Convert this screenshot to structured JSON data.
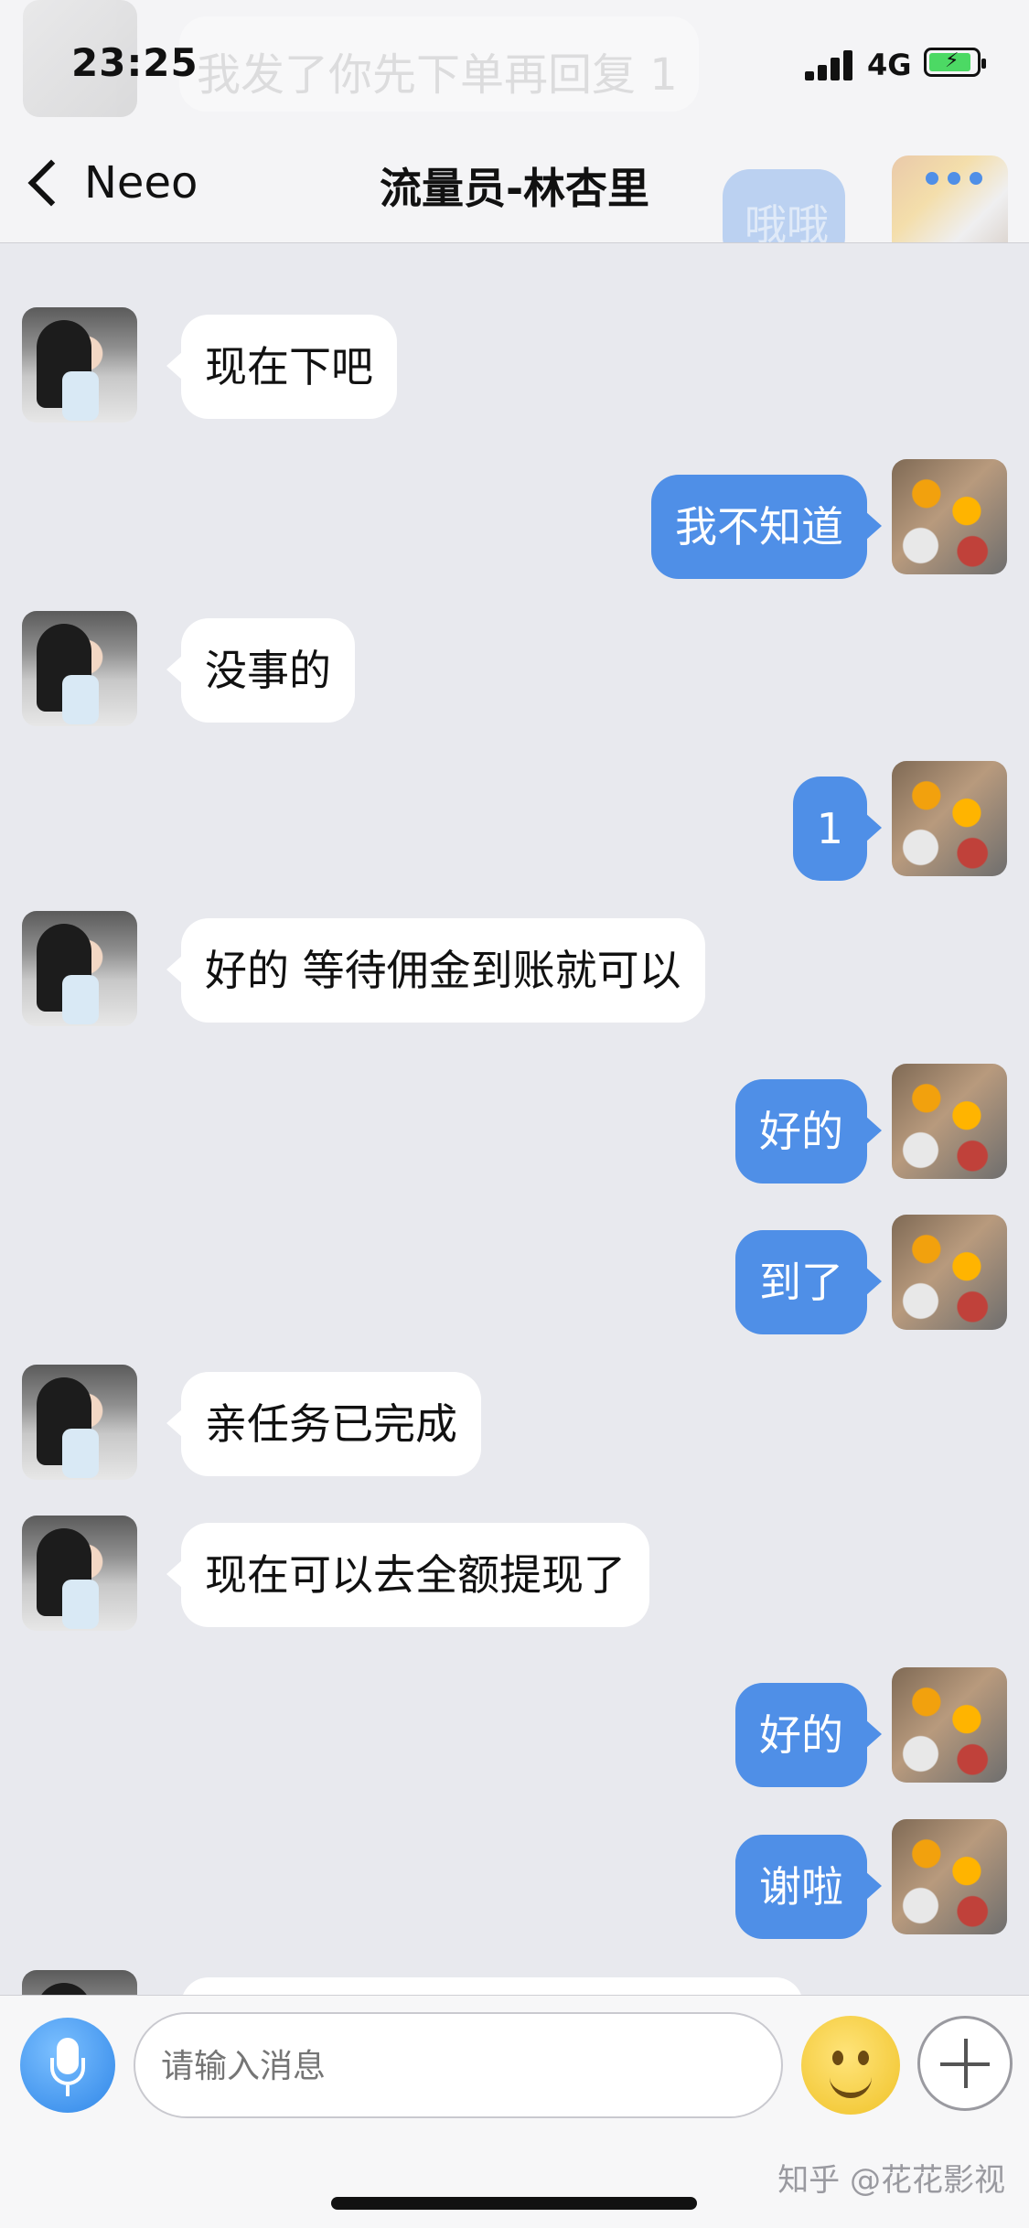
{
  "status_bar": {
    "time": "23:25",
    "network": "4G"
  },
  "ghost": {
    "incoming_text": "我发了你先下单再回复 1",
    "outgoing_text": "哦哦"
  },
  "nav": {
    "back_label": "Neeo",
    "title": "流量员-林杏里"
  },
  "messages": [
    {
      "dir": "in",
      "text": "现在下吧"
    },
    {
      "dir": "out",
      "text": "我不知道"
    },
    {
      "dir": "in",
      "text": "没事的"
    },
    {
      "dir": "out",
      "text": "1"
    },
    {
      "dir": "in",
      "text": "好的 等待佣金到账就可以"
    },
    {
      "dir": "out",
      "text": "好的"
    },
    {
      "dir": "out",
      "text": "到了"
    },
    {
      "dir": "in",
      "text": "亲任务已完成"
    },
    {
      "dir": "in",
      "text": "现在可以去全额提现了"
    },
    {
      "dir": "out",
      "text": "好的"
    },
    {
      "dir": "out",
      "text": "谢啦"
    }
  ],
  "input": {
    "placeholder": "请输入消息"
  },
  "watermark": "知乎 @花花影视",
  "colors": {
    "outgoing_bubble": "#4f8fe7",
    "incoming_bubble": "#ffffff",
    "chat_bg": "#e8e9ee"
  }
}
